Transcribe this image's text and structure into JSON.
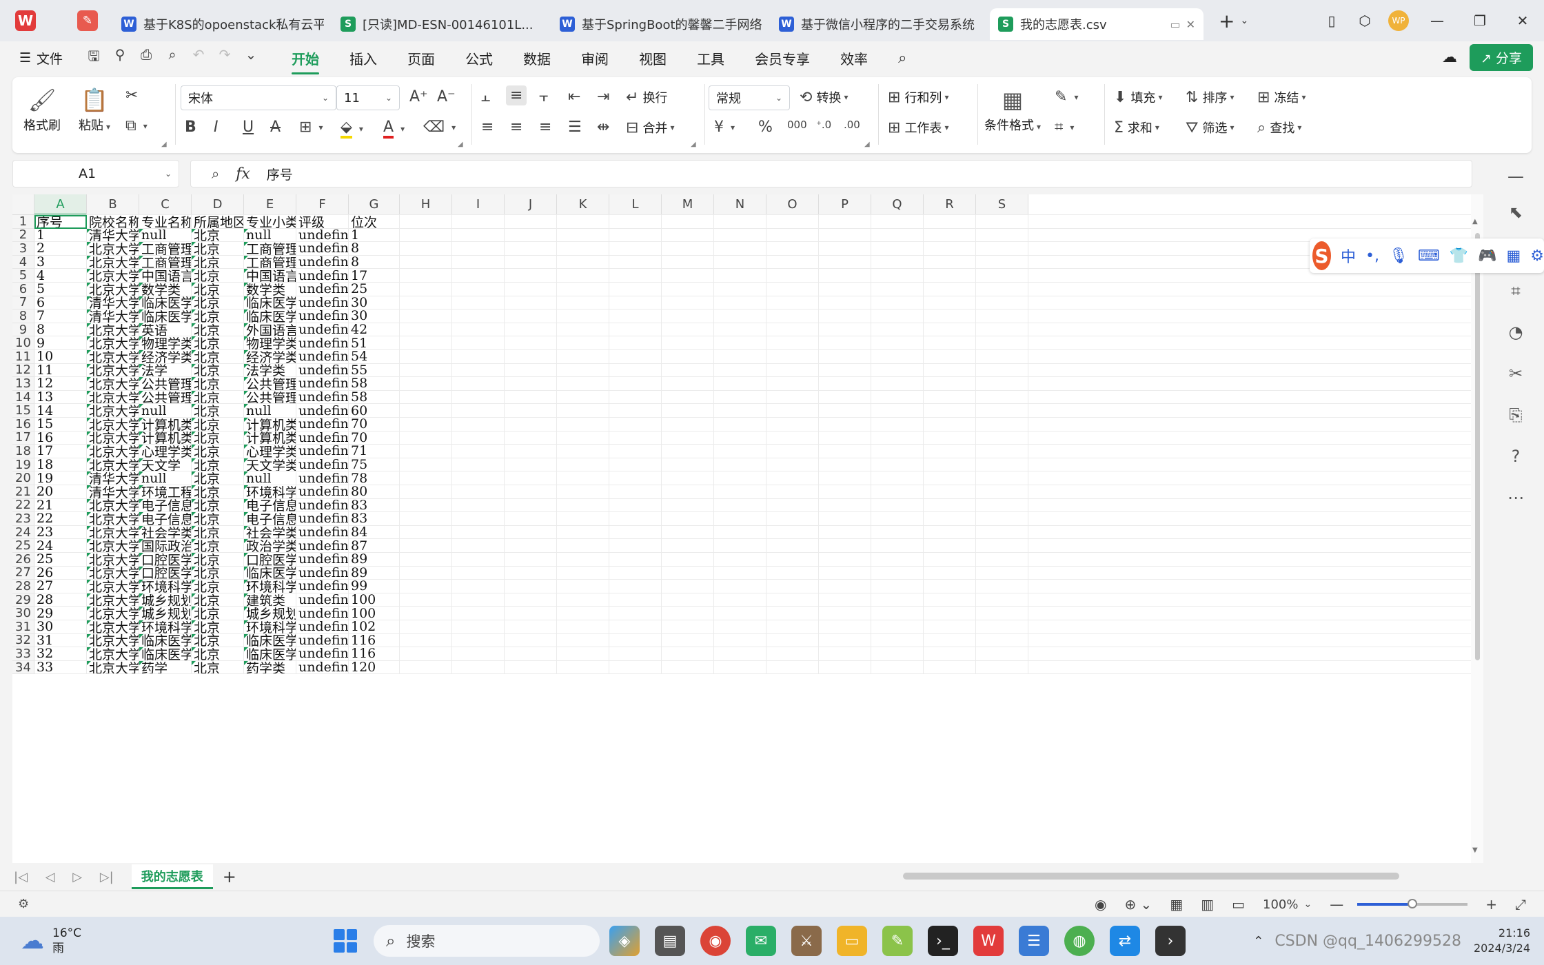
{
  "tabs": [
    {
      "icon": "W",
      "kind": "w",
      "title": "基于K8S的opoenstack私有云平"
    },
    {
      "icon": "S",
      "kind": "s",
      "title": "[只读]MD-ESN-00146101L..."
    },
    {
      "icon": "W",
      "kind": "w",
      "title": "基于SpringBoot的馨馨二手网络"
    },
    {
      "icon": "W",
      "kind": "w",
      "title": "基于微信小程序的二手交易系统"
    },
    {
      "icon": "S",
      "kind": "s",
      "title": "我的志愿表.csv"
    }
  ],
  "menubar": {
    "file": "文件",
    "menus": [
      "开始",
      "插入",
      "页面",
      "公式",
      "数据",
      "审阅",
      "视图",
      "工具",
      "会员专享",
      "效率"
    ],
    "active": "开始",
    "share": "分享"
  },
  "ribbon": {
    "format_painter": "格式刷",
    "paste": "粘贴",
    "font_name": "宋体",
    "font_size": "11",
    "wrap": "换行",
    "merge": "合并",
    "number_format": "常规",
    "convert": "转换",
    "rows_cols": "行和列",
    "worksheet": "工作表",
    "cond_format": "条件格式",
    "fill": "填充",
    "sort": "排序",
    "freeze": "冻结",
    "sum": "求和",
    "filter": "筛选",
    "find": "查找"
  },
  "formula": {
    "cell_ref": "A1",
    "fx": "fx",
    "value": "序号"
  },
  "columns": [
    "A",
    "B",
    "C",
    "D",
    "E",
    "F",
    "G",
    "H",
    "I",
    "J",
    "K",
    "L",
    "M",
    "N",
    "O",
    "P",
    "Q",
    "R",
    "S"
  ],
  "rows": [
    [
      "序号",
      "院校名称",
      "专业名称",
      "所属地区",
      "专业小类",
      "评级",
      "位次"
    ],
    [
      "1",
      "清华大学",
      "null",
      "北京",
      "null",
      "undefined",
      "1"
    ],
    [
      "2",
      "北京大学",
      "工商管理类",
      "北京",
      "工商管理类",
      "undefined",
      "8"
    ],
    [
      "3",
      "北京大学",
      "工商管理类",
      "北京",
      "工商管理类",
      "undefined",
      "8"
    ],
    [
      "4",
      "北京大学",
      "中国语言文学类",
      "北京",
      "中国语言文学类",
      "undefined",
      "17"
    ],
    [
      "5",
      "北京大学",
      "数学类",
      "北京",
      "数学类",
      "undefined",
      "25"
    ],
    [
      "6",
      "清华大学",
      "临床医学类",
      "北京",
      "临床医学类",
      "undefined",
      "30"
    ],
    [
      "7",
      "清华大学",
      "临床医学类",
      "北京",
      "临床医学类",
      "undefined",
      "30"
    ],
    [
      "8",
      "北京大学",
      "英语",
      "北京",
      "外国语言文学类",
      "undefined",
      "42"
    ],
    [
      "9",
      "北京大学",
      "物理学类",
      "北京",
      "物理学类",
      "undefined",
      "51"
    ],
    [
      "10",
      "北京大学",
      "经济学类",
      "北京",
      "经济学类",
      "undefined",
      "54"
    ],
    [
      "11",
      "北京大学",
      "法学",
      "北京",
      "法学类",
      "undefined",
      "55"
    ],
    [
      "12",
      "北京大学",
      "公共管理类",
      "北京",
      "公共管理类",
      "undefined",
      "58"
    ],
    [
      "13",
      "北京大学",
      "公共管理类",
      "北京",
      "公共管理类",
      "undefined",
      "58"
    ],
    [
      "14",
      "北京大学",
      "null",
      "北京",
      "null",
      "undefined",
      "60"
    ],
    [
      "15",
      "北京大学",
      "计算机类",
      "北京",
      "计算机类",
      "undefined",
      "70"
    ],
    [
      "16",
      "北京大学",
      "计算机类",
      "北京",
      "计算机类",
      "undefined",
      "70"
    ],
    [
      "17",
      "北京大学",
      "心理学类",
      "北京",
      "心理学类",
      "undefined",
      "71"
    ],
    [
      "18",
      "北京大学",
      "天文学",
      "北京",
      "天文学类",
      "undefined",
      "75"
    ],
    [
      "19",
      "清华大学",
      "null",
      "北京",
      "null",
      "undefined",
      "78"
    ],
    [
      "20",
      "清华大学",
      "环境工程",
      "北京",
      "环境科学与工程类",
      "undefined",
      "80"
    ],
    [
      "21",
      "北京大学",
      "电子信息类",
      "北京",
      "电子信息类",
      "undefined",
      "83"
    ],
    [
      "22",
      "北京大学",
      "电子信息类",
      "北京",
      "电子信息类",
      "undefined",
      "83"
    ],
    [
      "23",
      "北京大学",
      "社会学类",
      "北京",
      "社会学类",
      "undefined",
      "84"
    ],
    [
      "24",
      "北京大学",
      "国际政治",
      "北京",
      "政治学类",
      "undefined",
      "87"
    ],
    [
      "25",
      "北京大学医",
      "口腔医学",
      "北京",
      "口腔医学类",
      "undefined",
      "89"
    ],
    [
      "26",
      "北京大学医",
      "口腔医学",
      "北京",
      "临床医学类",
      "undefined",
      "89"
    ],
    [
      "27",
      "北京大学",
      "环境科学",
      "北京",
      "环境科学与工程类",
      "undefined",
      "99"
    ],
    [
      "28",
      "北京大学",
      "城乡规划",
      "北京",
      "建筑类",
      "undefined",
      "100"
    ],
    [
      "29",
      "北京大学",
      "城乡规划",
      "北京",
      "城乡规划与",
      "undefined",
      "100"
    ],
    [
      "30",
      "北京大学",
      "环境科学与",
      "北京",
      "环境科学与工程类",
      "undefined",
      "102"
    ],
    [
      "31",
      "北京大学医",
      "临床医学",
      "北京",
      "临床医学类",
      "undefined",
      "116"
    ],
    [
      "32",
      "北京大学医",
      "临床医学",
      "北京",
      "临床医学类",
      "undefined",
      "116"
    ],
    [
      "33",
      "北京大学医",
      "药学",
      "北京",
      "药学类",
      "undefined",
      "120"
    ]
  ],
  "sheet": {
    "name": "我的志愿表"
  },
  "status": {
    "zoom": "100%",
    "zoom_fraction": 0.5
  },
  "taskbar": {
    "temp": "16°C",
    "weather": "雨",
    "search": "搜索",
    "time": "21:16",
    "date": "2024/3/24",
    "watermark": "CSDN @qq_1406299528"
  },
  "colors": {
    "accent": "#1e9c5b",
    "word": "#2d5fd6",
    "wps_red": "#e23b3b"
  }
}
